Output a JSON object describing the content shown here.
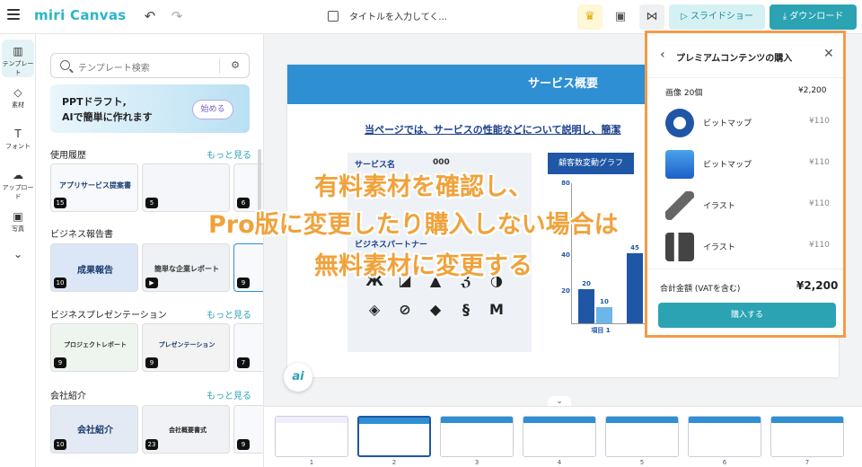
{
  "app": {
    "logo": "miri Canvas",
    "title_placeholder": "タイトルを入力してく...",
    "slideshow_label": "スライドショー",
    "download_label": "ダウンロード"
  },
  "rail": [
    {
      "label": "テンプレート",
      "icon": "template-icon"
    },
    {
      "label": "素材",
      "icon": "material-icon"
    },
    {
      "label": "フォント",
      "icon": "font-icon"
    },
    {
      "label": "アップロード",
      "icon": "upload-icon"
    },
    {
      "label": "写真",
      "icon": "photo-icon"
    }
  ],
  "panel": {
    "search_placeholder": "テンプレート検索",
    "promo_line1": "PPTドラフト,",
    "promo_line2": "AIで簡単に作れます",
    "promo_button": "始める",
    "more": "もっと見る",
    "sections": [
      {
        "title": "使用履歴",
        "show_more": true,
        "thumbs": [
          {
            "title": "アプリサービス提案書",
            "count": "15"
          },
          {
            "title": "",
            "count": "5"
          },
          {
            "title": "",
            "count": "6"
          }
        ]
      },
      {
        "title": "ビジネス報告書",
        "show_more": false,
        "thumbs": [
          {
            "title": "成果報告",
            "count": "10"
          },
          {
            "title": "簡単な企業レポート",
            "count": ""
          },
          {
            "title": "",
            "count": "9"
          }
        ]
      },
      {
        "title": "ビジネスプレゼンテーション",
        "show_more": true,
        "thumbs": [
          {
            "title": "プロジェクトレポート",
            "count": "9"
          },
          {
            "title": "プレゼンテーション",
            "count": "9"
          },
          {
            "title": "",
            "count": "7"
          }
        ]
      },
      {
        "title": "会社紹介",
        "show_more": true,
        "thumbs": [
          {
            "title": "会社紹介",
            "count": "10"
          },
          {
            "title": "会社概要書式",
            "count": "23"
          },
          {
            "title": "",
            "count": "9"
          }
        ]
      }
    ]
  },
  "slide": {
    "header": "サービス概要",
    "subtitle": "当ページでは、サービスの性能などについて説明し、簡潔",
    "service_label": "サービス名",
    "service_value": "000",
    "partner_label": "ビジネスパートナー",
    "chart_button": "顧客数変動グラフ",
    "bar_labels": [
      "20",
      "10",
      "45"
    ],
    "x_labels": [
      "項目 1"
    ],
    "y_labels": [
      "80",
      "60",
      "40",
      "20"
    ]
  },
  "overlay": {
    "line1": "有料素材を確認し、",
    "line2": "Pro版に変更したり購入しない場合は",
    "line3": "無料素材に変更する"
  },
  "modal": {
    "title": "プレミアムコンテンツの購入",
    "summary_label": "画像 20個",
    "summary_price": "¥2,200",
    "items": [
      {
        "name": "ビットマップ",
        "price": "¥110"
      },
      {
        "name": "ビットマップ",
        "price": "¥110"
      },
      {
        "name": "イラスト",
        "price": "¥110"
      },
      {
        "name": "イラスト",
        "price": "¥110"
      }
    ],
    "total_label": "合計金額 (VATを含む)",
    "total_price": "¥2,200",
    "buy_label": "購入する"
  },
  "strip": {
    "pages": [
      "1",
      "2",
      "3",
      "4",
      "5",
      "6",
      "7"
    ]
  }
}
